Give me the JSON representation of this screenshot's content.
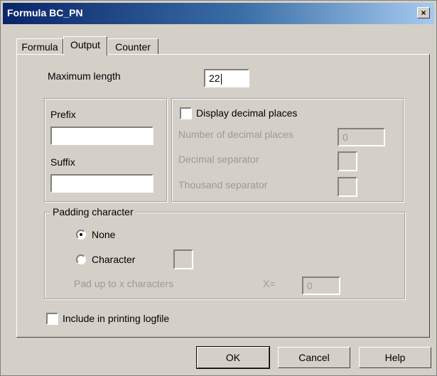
{
  "window": {
    "title": "Formula BC_PN",
    "close_label": "×"
  },
  "tabs": [
    {
      "label": "Formula",
      "active": false
    },
    {
      "label": "Output",
      "active": true
    },
    {
      "label": "Counter",
      "active": false
    }
  ],
  "max_length": {
    "label": "Maximum length",
    "value": "22"
  },
  "prefix": {
    "label": "Prefix",
    "value": ""
  },
  "suffix": {
    "label": "Suffix",
    "value": ""
  },
  "decimal": {
    "display_label": "Display decimal places",
    "display_checked": false,
    "number_label": "Number of decimal places",
    "number_value": "0",
    "separator_label": "Decimal separator",
    "separator_value": "",
    "thousand_label": "Thousand separator",
    "thousand_value": ""
  },
  "padding": {
    "legend": "Padding character",
    "none_label": "None",
    "none_selected": true,
    "character_label": "Character",
    "character_value": "",
    "pad_label": "Pad up to x characters",
    "x_label": "X=",
    "x_value": "0"
  },
  "logfile": {
    "label": "Include in printing logfile",
    "checked": false
  },
  "buttons": {
    "ok": "OK",
    "cancel": "Cancel",
    "help": "Help"
  }
}
